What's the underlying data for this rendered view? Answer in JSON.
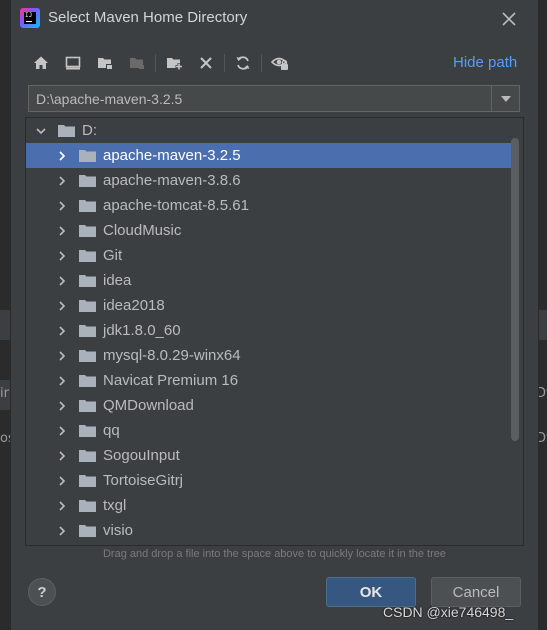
{
  "dialog": {
    "title": "Select Maven Home Directory",
    "app_icon_text": "IJ",
    "hide_path_label": "Hide path",
    "path_value": "D:\\apache-maven-3.2.5",
    "hint": "Drag and drop a file into the space above to quickly locate it in the tree",
    "ok_label": "OK",
    "cancel_label": "Cancel",
    "help_label": "?"
  },
  "toolbar": {
    "icons": [
      "home-icon",
      "desktop-icon",
      "project-folder-icon",
      "module-folder-icon",
      "new-folder-icon",
      "delete-icon",
      "refresh-icon",
      "show-hidden-icon"
    ]
  },
  "tree": {
    "root": "D:",
    "selected_index": 0,
    "items": [
      "apache-maven-3.2.5",
      "apache-maven-3.8.6",
      "apache-tomcat-8.5.61",
      "CloudMusic",
      "Git",
      "idea",
      "idea2018",
      "jdk1.8.0_60",
      "mysql-8.0.29-winx64",
      "Navicat Premium 16",
      "QMDownload",
      "qq",
      "SogouInput",
      "TortoiseGitrj",
      "txgl",
      "visio"
    ]
  },
  "background": {
    "left_frag_1": "ir",
    "left_frag_2": "os",
    "right_frag_1": "Dv",
    "right_frag_2": "Dv"
  },
  "watermark": "CSDN @xie746498_",
  "colors": {
    "accent_link": "#589df6",
    "selection": "#4b6eaf",
    "ok_button": "#365880",
    "folder": "#a9b1bb"
  }
}
